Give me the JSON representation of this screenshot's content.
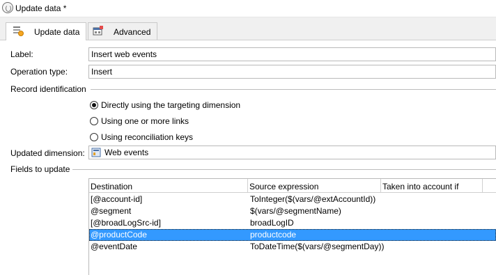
{
  "window": {
    "title": "Update data *"
  },
  "tabs": [
    {
      "label": "Update data",
      "icon": "update-data-icon",
      "active": true
    },
    {
      "label": "Advanced",
      "icon": "advanced-settings-icon",
      "active": false
    }
  ],
  "form": {
    "label": {
      "caption": "Label:",
      "value": "Insert web events"
    },
    "operation_type": {
      "caption": "Operation type:",
      "value": "Insert"
    },
    "record_identification": {
      "caption": "Record identification",
      "options": [
        {
          "label": "Directly using the targeting dimension",
          "selected": true
        },
        {
          "label": "Using one or more links",
          "selected": false
        },
        {
          "label": "Using reconciliation keys",
          "selected": false
        }
      ]
    },
    "updated_dimension": {
      "caption": "Updated dimension:",
      "value": "Web events",
      "icon": "schema-table-icon"
    },
    "fields_to_update": {
      "caption": "Fields to update"
    }
  },
  "grid": {
    "columns": [
      "Destination",
      "Source expression",
      "Taken into account if"
    ],
    "rows": [
      {
        "destination": "[@account-id]",
        "source": "ToInteger($(vars/@extAccountId))",
        "condition": ""
      },
      {
        "destination": "@segment",
        "source": "$(vars/@segmentName)",
        "condition": ""
      },
      {
        "destination": "[@broadLogSrc-id]",
        "source": "broadLogID",
        "condition": ""
      },
      {
        "destination": "@productCode",
        "source": "productcode",
        "condition": "",
        "selected": true
      },
      {
        "destination": "@eventDate",
        "source": "ToDateTime($(vars/@segmentDay))",
        "condition": ""
      }
    ]
  },
  "colors": {
    "selection": "#3399ff",
    "tab_bar": "#f0f0f0"
  }
}
